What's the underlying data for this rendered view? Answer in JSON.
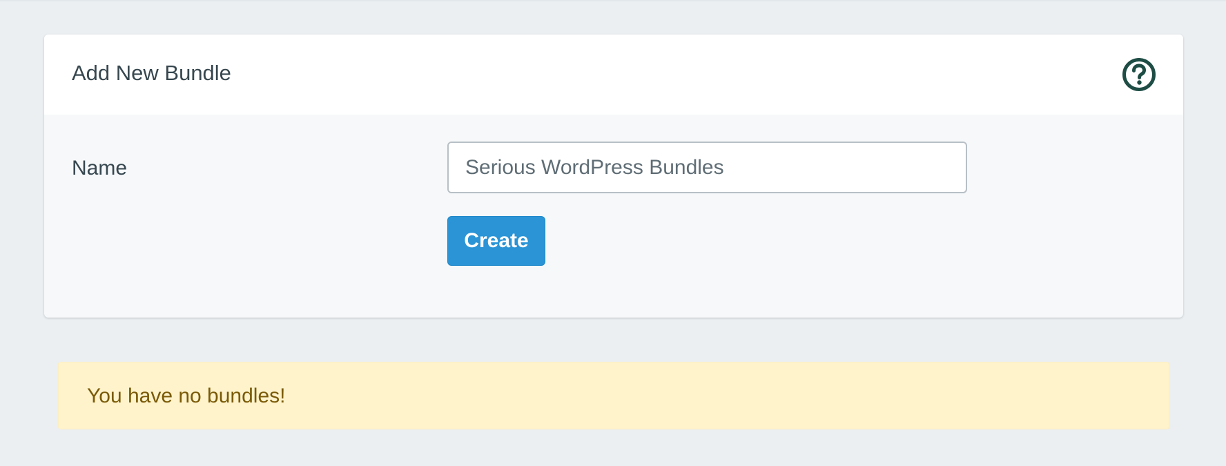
{
  "panel": {
    "title": "Add New Bundle",
    "help_icon": "question-circle-icon",
    "form": {
      "name_label": "Name",
      "name_value": "Serious WordPress Bundles",
      "create_label": "Create"
    }
  },
  "alert": {
    "message": "You have no bundles!"
  },
  "colors": {
    "page_bg": "#ebeff2",
    "button_bg": "#2a94d6",
    "alert_bg": "#fff3cc",
    "alert_text": "#7a5a07",
    "icon": "#1e4d45"
  }
}
